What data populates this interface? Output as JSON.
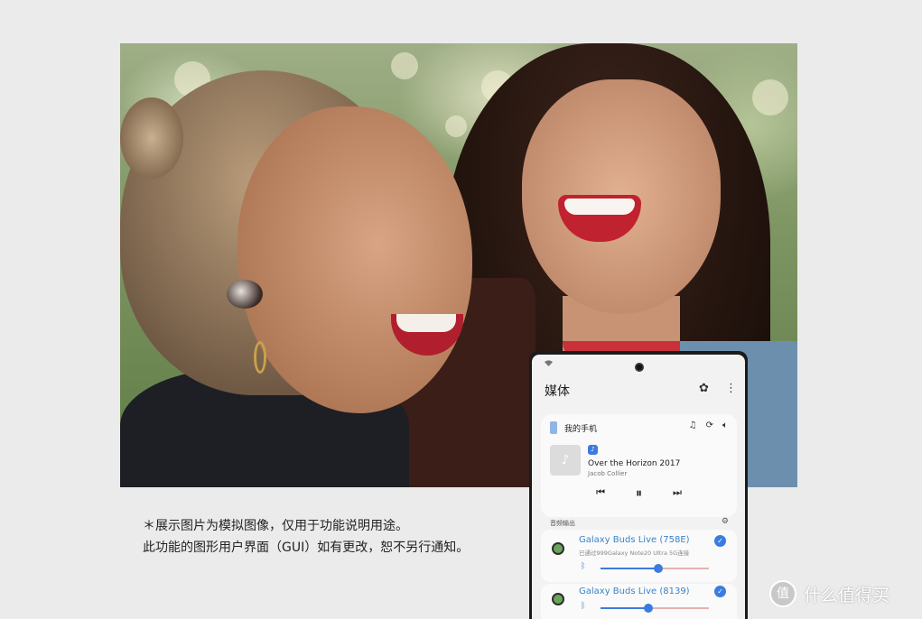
{
  "caption": {
    "line1": "＊展示图片为模拟图像，仅用于功能说明用途。",
    "line2": "此功能的图形用户界面（GUI）如有更改，恕不另行通知。"
  },
  "phone": {
    "header_title": "媒体",
    "header_icons": [
      "bixby-icon",
      "more-vertical-icon"
    ],
    "device_name": "我的手机",
    "track_title": "Over the Horizon 2017",
    "track_artist": "Jacob Collier",
    "audio_output_label": "音频输出",
    "outputs": [
      {
        "name": "Galaxy Buds Live (758E)",
        "subtitle": "已通过999Galaxy Note20 Ultra 5G连接",
        "volume": 0.53,
        "selected": true
      },
      {
        "name": "Galaxy Buds Live (8139)",
        "volume": 0.44,
        "selected": true
      }
    ],
    "accent_color": "#3c7be0"
  },
  "watermark": {
    "logo_glyph": "值",
    "text": "什么值得买"
  }
}
